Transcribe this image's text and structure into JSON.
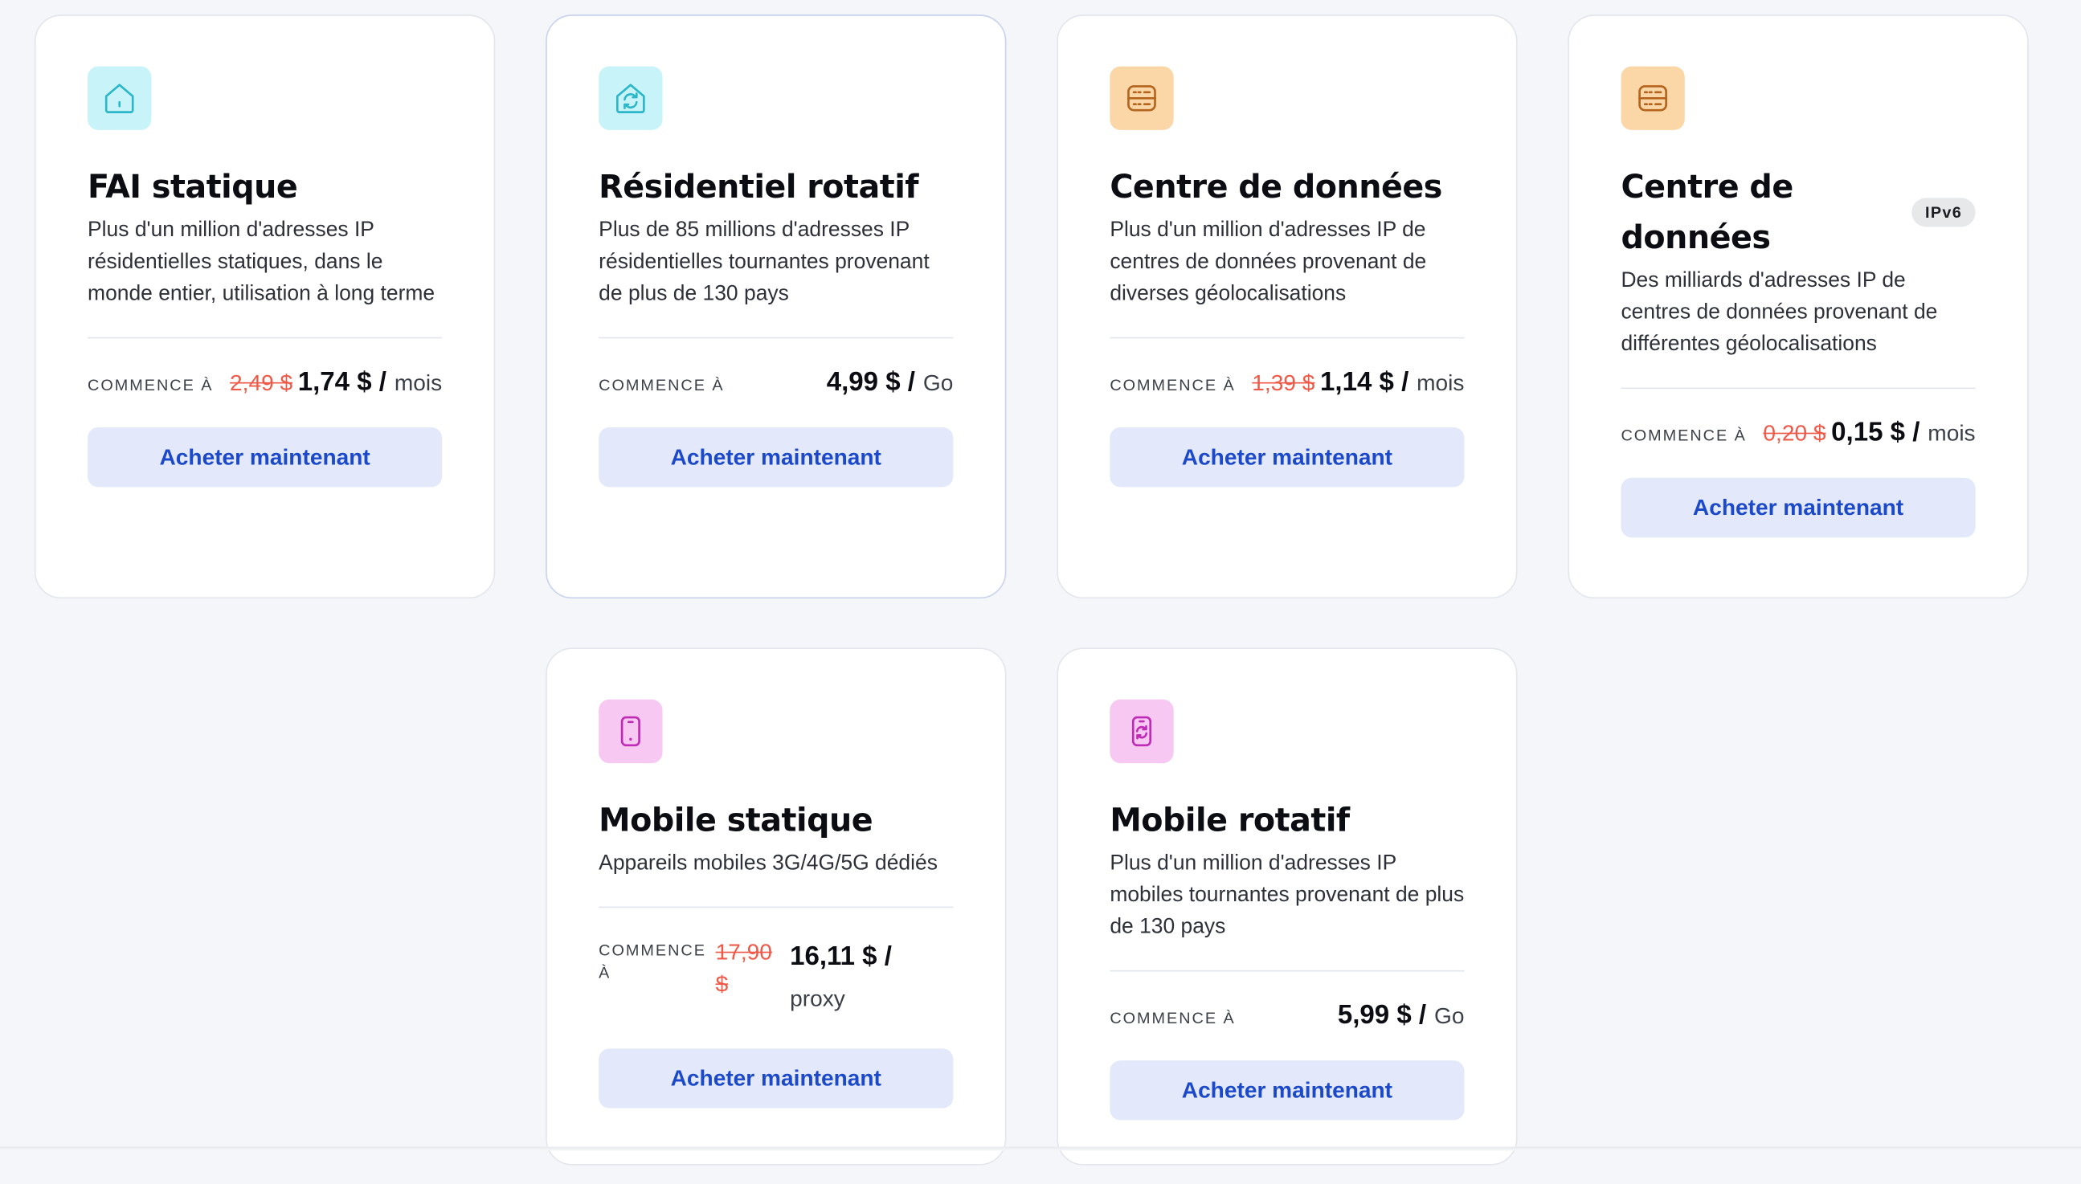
{
  "colors": {
    "teal_icon_bg": "#c8f3f8",
    "teal_icon": "#2bb6c9",
    "orange_icon_bg": "#fbd7a8",
    "orange_icon": "#b4641c",
    "pink_icon_bg": "#f6c8f2",
    "pink_icon": "#c02bb6",
    "button_bg": "#e3e9fb",
    "button_text": "#1b49c9",
    "old_price": "#ef5a48"
  },
  "cards": [
    {
      "icon": "house-icon",
      "title": "FAI statique",
      "description": "Plus d'un million d'adresses IP résidentielles statiques, dans le monde entier, utilisation à long terme",
      "starts_at": "COMMENCE À",
      "old_price": "2,49 $",
      "new_price": "1,74 $ /",
      "unit": "mois",
      "button": "Acheter maintenant"
    },
    {
      "icon": "rotating-house-icon",
      "title": "Résidentiel rotatif",
      "description": "Plus de 85 millions d'adresses IP résidentielles tournantes provenant de plus de 130 pays",
      "starts_at": "COMMENCE À",
      "new_price": "4,99 $ /",
      "unit": "Go",
      "button": "Acheter maintenant"
    },
    {
      "icon": "server-icon",
      "title": "Centre de données",
      "description": "Plus d'un million d'adresses IP de centres de données provenant de diverses géolocalisations",
      "starts_at": "COMMENCE À",
      "old_price": "1,39 $",
      "new_price": "1,14 $ /",
      "unit": "mois",
      "button": "Acheter maintenant"
    },
    {
      "icon": "server-icon",
      "title": "Centre de données",
      "badge": "IPv6",
      "description": "Des milliards d'adresses IP de centres de données provenant de différentes géolocalisations",
      "starts_at": "COMMENCE À",
      "old_price": "0,20 $",
      "new_price": "0,15 $ /",
      "unit": "mois",
      "button": "Acheter maintenant"
    },
    {
      "icon": "mobile-phone-icon",
      "title": "Mobile statique",
      "description": "Appareils mobiles 3G/4G/5G dédiés",
      "starts_at": "COMMENCE À",
      "old_price": "17,90 $",
      "new_price": "16,11 $ /",
      "unit": "proxy",
      "button": "Acheter maintenant"
    },
    {
      "icon": "rotating-mobile-icon",
      "title": "Mobile rotatif",
      "description": "Plus d'un million d'adresses IP mobiles tournantes provenant de plus de 130 pays",
      "starts_at": "COMMENCE À",
      "new_price": "5,99 $ /",
      "unit": "Go",
      "button": "Acheter maintenant"
    }
  ]
}
